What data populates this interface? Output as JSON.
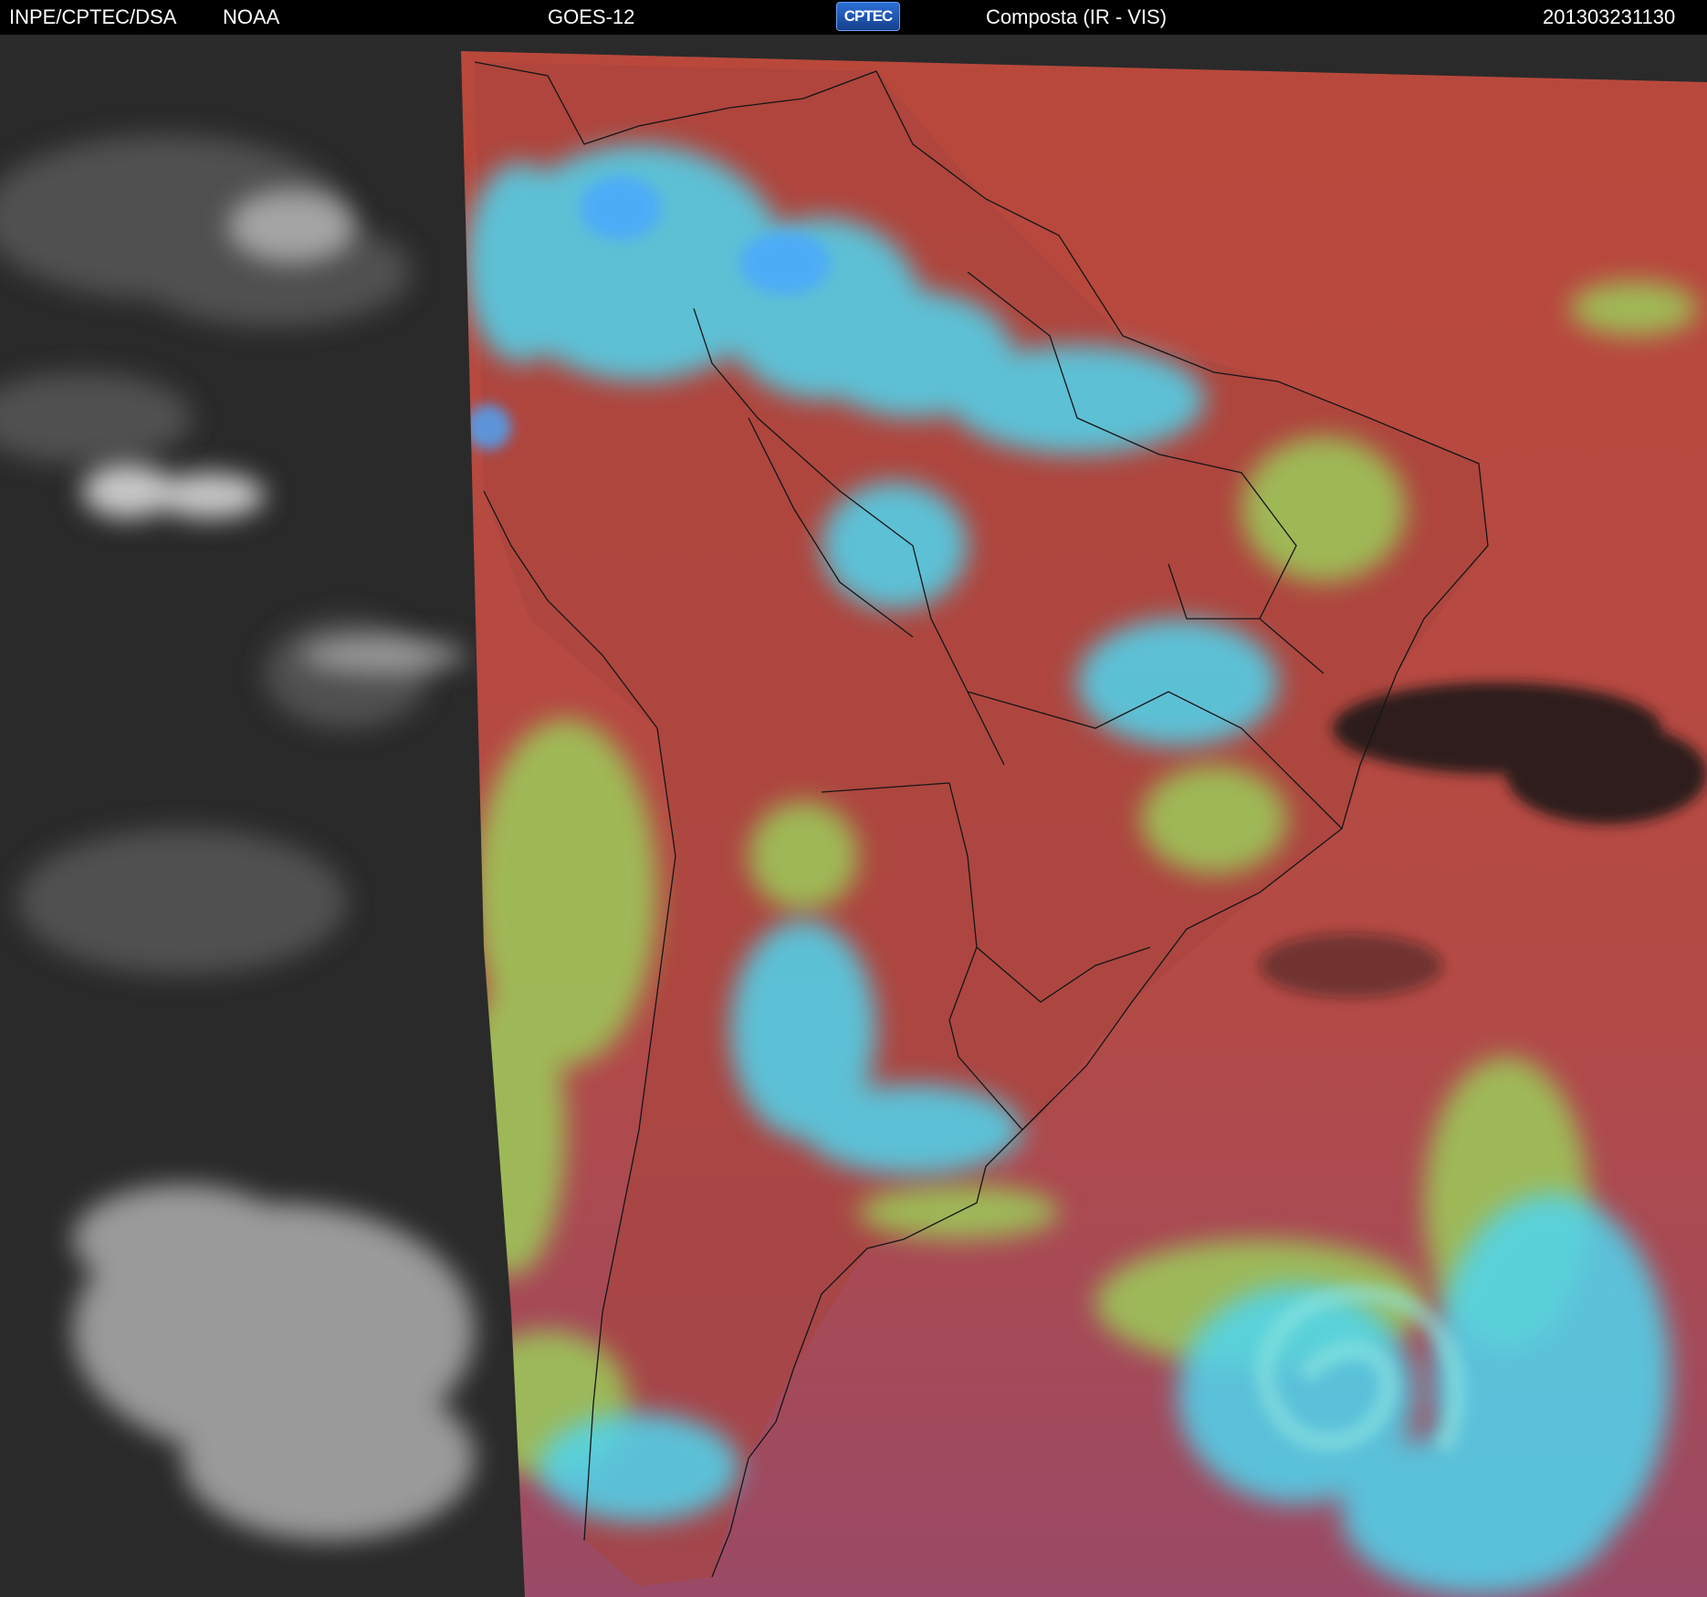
{
  "header": {
    "agency": "INPE/CPTEC/DSA",
    "source": "NOAA",
    "satellite": "GOES-12",
    "logo_text": "CPTEC",
    "product": "Composta (IR - VIS)",
    "timestamp": "201303231130"
  },
  "image": {
    "type": "satellite composite",
    "regions": [
      "night-side infrared (grayscale)",
      "day-side composite (color)"
    ],
    "colors": {
      "clear_ocean": "#b8453b",
      "low_cloud": "#9ccc5a",
      "high_cloud": "#4fd6f0",
      "deep_convection": "#4aa8ff",
      "ir_background": "#2b2b2b",
      "ir_cloud": "#d8d8d8",
      "no_data": "#111111"
    }
  }
}
